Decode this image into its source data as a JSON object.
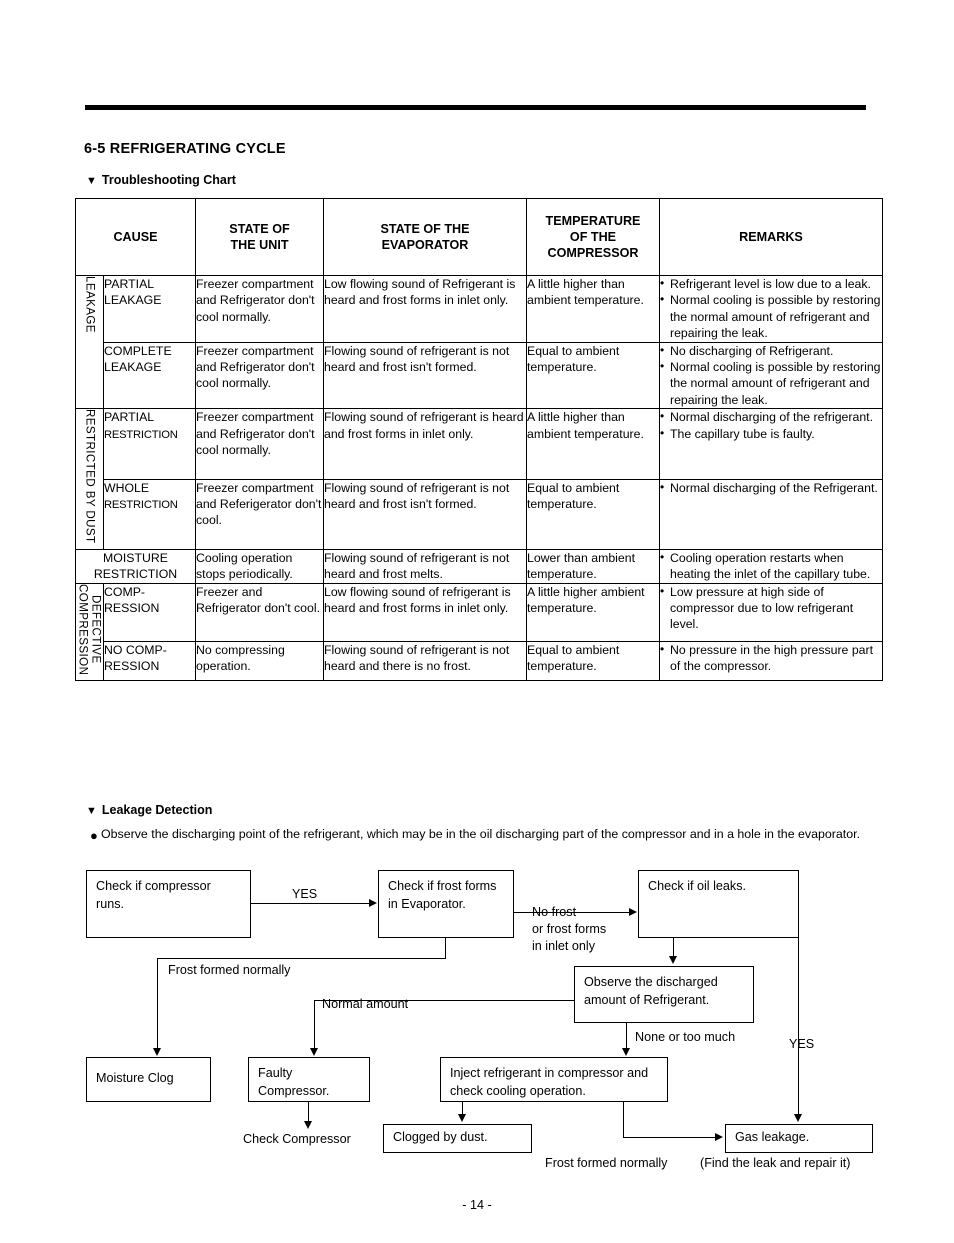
{
  "page": {
    "section_title": "6-5 REFRIGERATING CYCLE",
    "footer": "- 14 -"
  },
  "subheads": {
    "troubleshooting": "Troubleshooting Chart",
    "leakage_detection": "Leakage Detection",
    "triangle": "▼"
  },
  "table": {
    "headers": [
      "CAUSE",
      "STATE OF\nTHE UNIT",
      "STATE OF THE\nEVAPORATOR",
      "TEMPERATURE\nOF THE\nCOMPRESSOR",
      "REMARKS"
    ],
    "header_cause": "CAUSE",
    "header_state_unit_l1": "STATE OF",
    "header_state_unit_l2": "THE UNIT",
    "header_state_evap_l1": "STATE OF THE",
    "header_state_evap_l2": "EVAPORATOR",
    "header_temp_l1": "TEMPERATURE",
    "header_temp_l2": "OF THE",
    "header_temp_l3": "COMPRESSOR",
    "header_remarks": "REMARKS",
    "groups": {
      "leakage": "LEAKAGE",
      "restricted": "RESTRICTED BY DUST",
      "defective_l1": "DEFECTIVE",
      "defective_l2": "COMPRESSION"
    },
    "rows": [
      {
        "cause_l1": "PARTIAL",
        "cause_l2": "LEAKAGE",
        "cause_l2_small": false,
        "state_unit": "Freezer compartment and Refrigerator don't cool normally.",
        "state_evap": "Low flowing sound of Refrigerant is heard and frost forms in inlet only.",
        "temperature": "A little higher than ambient temperature.",
        "remarks": [
          "Refrigerant level is low due to a leak.",
          "Normal cooling is possible by restoring the normal amount of refrigerant and repairing the leak."
        ]
      },
      {
        "cause_l1": "COMPLETE",
        "cause_l2": "LEAKAGE",
        "cause_l2_small": false,
        "state_unit": "Freezer compartment and Refrigerator don't cool normally.",
        "state_evap": "Flowing sound of refrigerant is not heard and frost isn't formed.",
        "temperature": "Equal to ambient temperature.",
        "remarks": [
          "No discharging of Refrigerant.",
          "Normal cooling is possible by restoring the normal amount of refrigerant and repairing the leak."
        ]
      },
      {
        "cause_l1": "PARTIAL",
        "cause_l2": "RESTRICTION",
        "cause_l2_small": true,
        "state_unit": "Freezer compartment and Refrigerator don't cool normally.",
        "state_evap": "Flowing sound of refrigerant is heard and frost forms in inlet only.",
        "temperature": "A little higher than ambient temperature.",
        "remarks": [
          "Normal discharging of the refrigerant.",
          "The capillary tube is faulty."
        ]
      },
      {
        "cause_l1": "WHOLE",
        "cause_l2": "RESTRICTION",
        "cause_l2_small": true,
        "state_unit": "Freezer compartment and Referigerator don't cool.",
        "state_evap": "Flowing sound of refrigerant is not heard and frost isn't formed.",
        "temperature": "Equal to ambient temperature.",
        "remarks": [
          "Normal discharging of the Refrigerant."
        ]
      },
      {
        "cause_l1": "MOISTURE",
        "cause_l2": "RESTRICTION",
        "cause_l2_small": true,
        "state_unit": "Cooling operation stops periodically.",
        "state_evap": "Flowing sound of refrigerant is not heard and frost melts.",
        "temperature": "Lower than ambient temperature.",
        "remarks": [
          "Cooling operation restarts when heating the inlet of the capillary tube."
        ]
      },
      {
        "cause_l1": "COMP-",
        "cause_l2": "RESSION",
        "cause_l2_small": false,
        "state_unit": "Freezer and Refrigerator don't cool.",
        "state_evap": "Low flowing sound of refrigerant is heard and frost forms in inlet only.",
        "temperature": "A little higher ambient temperature.",
        "remarks": [
          "Low pressure at high side of compressor due to low refrigerant level."
        ]
      },
      {
        "cause_l1": "NO COMP-",
        "cause_l2": "RESSION",
        "cause_l2_small": false,
        "state_unit": "No compressing operation.",
        "state_evap": "Flowing sound of refrigerant is not heard and there is no frost.",
        "temperature": "Equal to ambient temperature.",
        "remarks": [
          "No pressure in the high pressure part of the compressor."
        ]
      }
    ]
  },
  "leakage_detection": {
    "intro_bullet": "●",
    "intro_text": "Observe the discharging point of the refrigerant, which may be in the oil discharging part of the compressor and in a hole in the evaporator."
  },
  "flowchart": {
    "boxes": {
      "check_compressor": "Check if compressor runs.",
      "check_frost": "Check if frost forms in Evaporator.",
      "check_oil": "Check if oil leaks.",
      "observe_discharged": "Observe the discharged amount of Refrigerant.",
      "moisture_clog": "Moisture Clog",
      "faulty_compressor": "Faulty Compressor.",
      "inject_refrigerant": "Inject refrigerant in compressor and check cooling operation.",
      "clogged_dust": "Clogged by dust.",
      "gas_leakage": "Gas leakage."
    },
    "labels": {
      "yes_1": "YES",
      "no_frost_l1": "No frost",
      "no_frost_l2": "or frost forms",
      "no_frost_l3": "in inlet only",
      "frost_formed_normally_1": "Frost formed normally",
      "normal_amount": "Normal amount",
      "none_or_too_much": "None or too much",
      "yes_2": "YES",
      "check_compressor_label": "Check Compressor",
      "frost_formed_normally_2": "Frost formed normally",
      "find_leak": "(Find the leak and repair it)"
    }
  }
}
